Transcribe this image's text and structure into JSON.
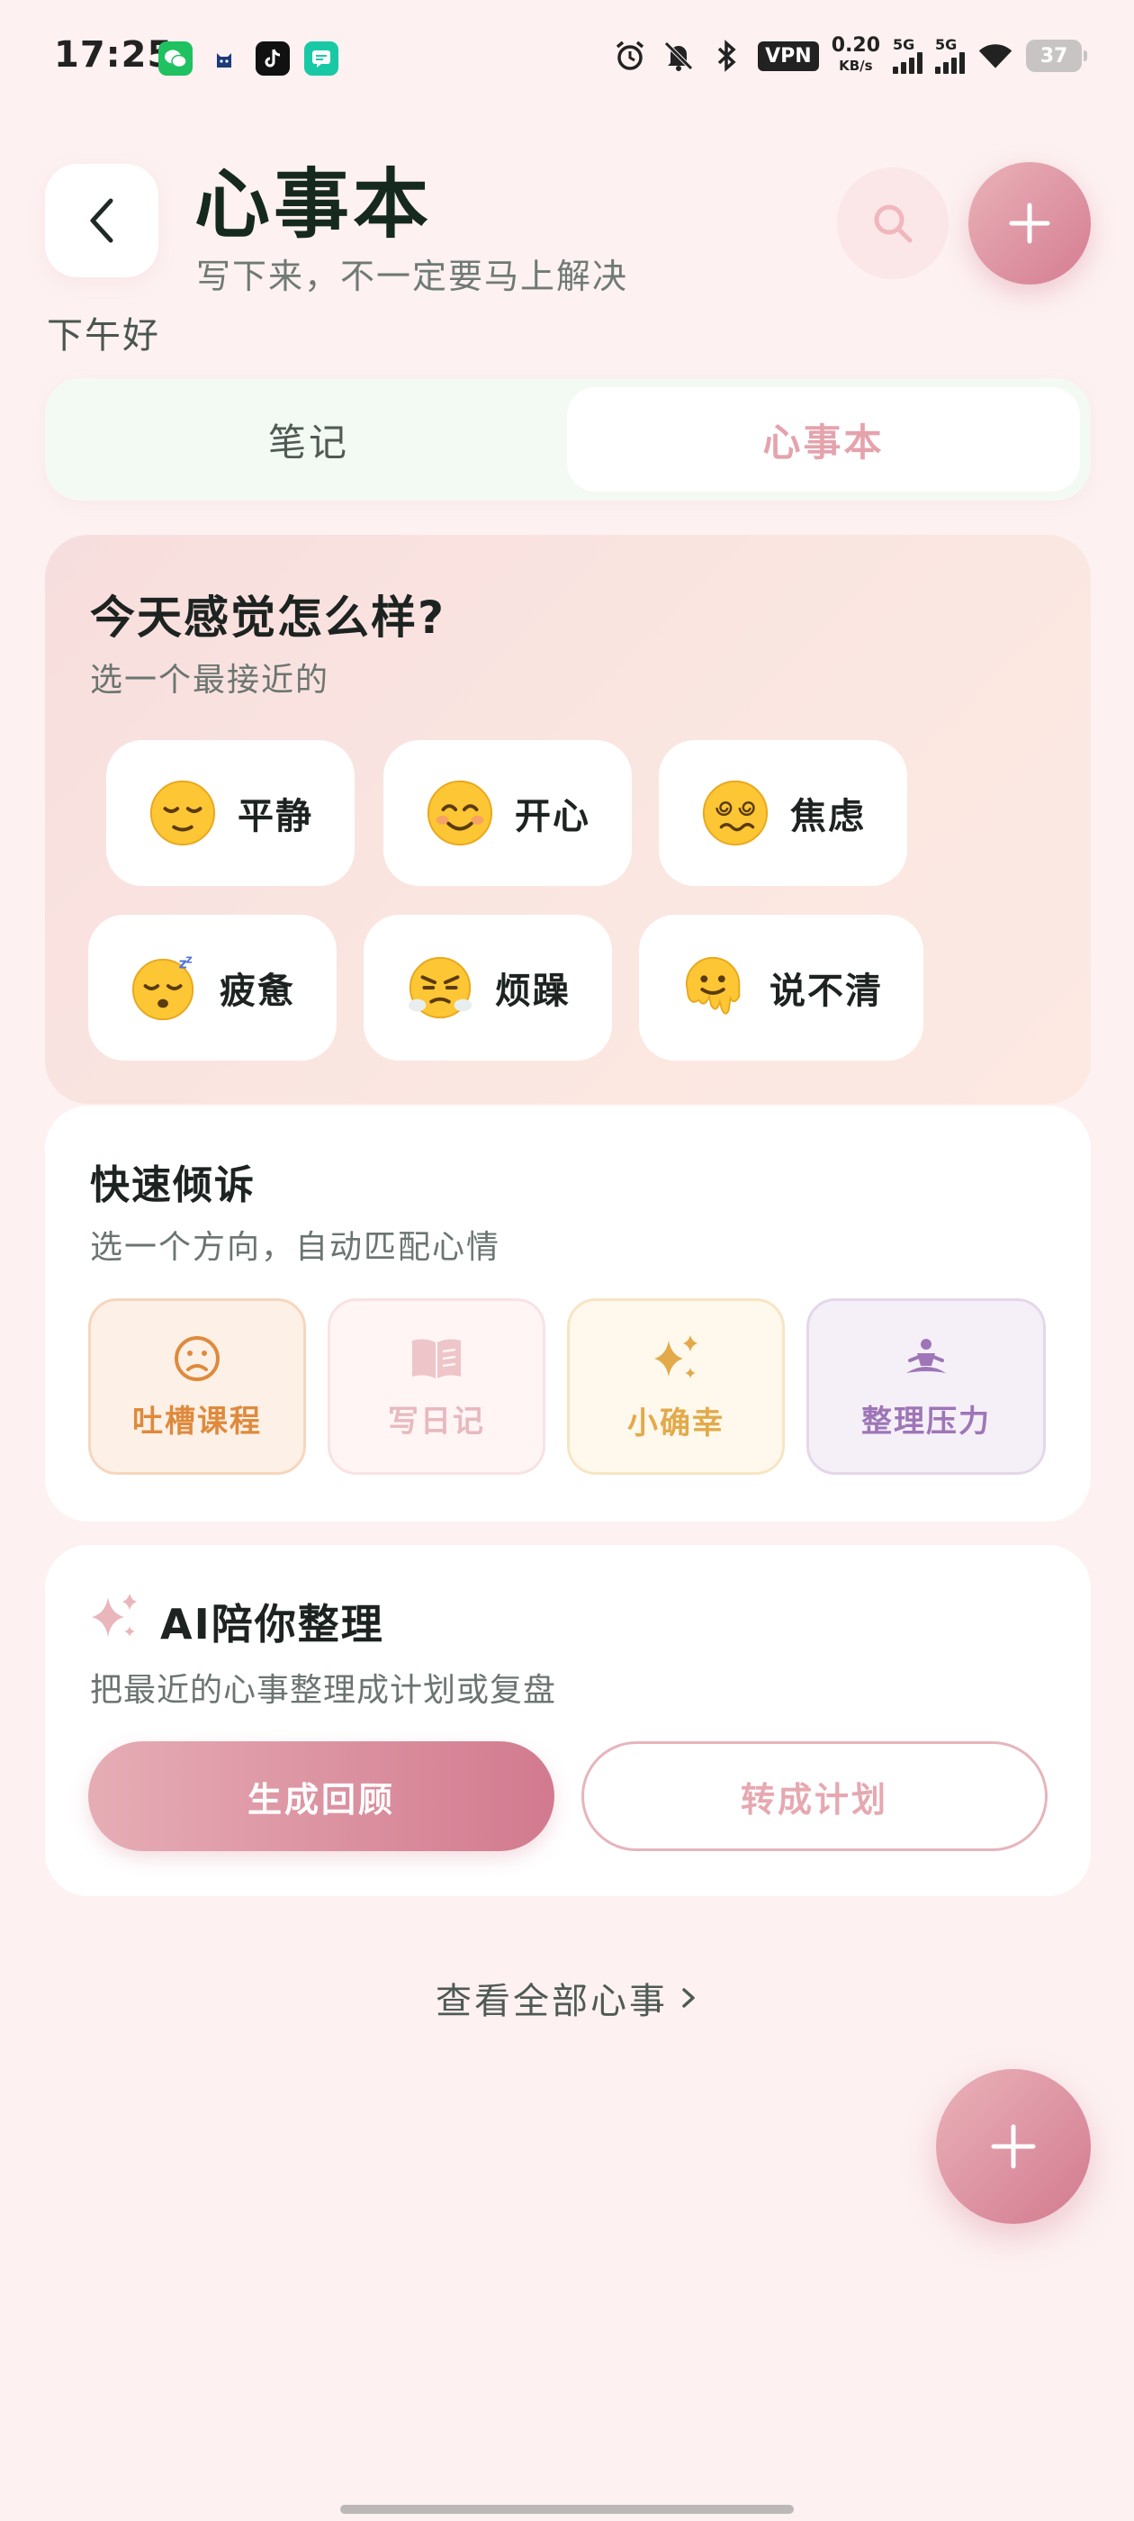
{
  "status_bar": {
    "time": "17:25",
    "vpn": "VPN",
    "net_speed": "0.20",
    "net_unit": "KB/s",
    "signal_1_label": "5G",
    "signal_2_label": "5G",
    "battery": "37",
    "icons": [
      "wechat-icon",
      "cat-app-icon",
      "tiktok-icon",
      "message-app-icon",
      "alarm-icon",
      "mute-icon",
      "bluetooth-icon",
      "wifi-icon"
    ]
  },
  "header": {
    "title": "心事本",
    "subtitle": "写下来，不一定要马上解决",
    "greeting": "下午好",
    "icons": [
      "back-icon",
      "search-icon",
      "plus-icon"
    ]
  },
  "tabs": [
    {
      "label": "笔记",
      "active": false
    },
    {
      "label": "心事本",
      "active": true
    }
  ],
  "mood": {
    "title": "今天感觉怎么样?",
    "subtitle": "选一个最接近的",
    "options": [
      {
        "label": "平静",
        "icon": "relieved-face-icon"
      },
      {
        "label": "开心",
        "icon": "smiling-face-icon"
      },
      {
        "label": "焦虑",
        "icon": "dizzy-face-icon"
      },
      {
        "label": "疲惫",
        "icon": "sleeping-face-icon"
      },
      {
        "label": "烦躁",
        "icon": "steaming-face-icon"
      },
      {
        "label": "说不清",
        "icon": "melting-face-icon"
      }
    ]
  },
  "quick_vent": {
    "title": "快速倾诉",
    "subtitle": "选一个方向，自动匹配心情",
    "options": [
      {
        "label": "吐槽课程",
        "icon": "frown-icon",
        "color": "#de8a3c"
      },
      {
        "label": "写日记",
        "icon": "book-icon",
        "color": "#e8b9be"
      },
      {
        "label": "小确幸",
        "icon": "sparkle-icon",
        "color": "#e2aa4a"
      },
      {
        "label": "整理压力",
        "icon": "meditation-icon",
        "color": "#9e76b7"
      }
    ]
  },
  "ai": {
    "title": "AI陪你整理",
    "subtitle": "把最近的心事整理成计划或复盘",
    "primary_label": "生成回顾",
    "secondary_label": "转成计划"
  },
  "footer": {
    "view_all": "查看全部心事"
  },
  "colors": {
    "background": "#fdf1f1",
    "accent": "#d27a8f",
    "accent_light": "#eab2b9",
    "tab_active_text": "#e4a3ad"
  }
}
